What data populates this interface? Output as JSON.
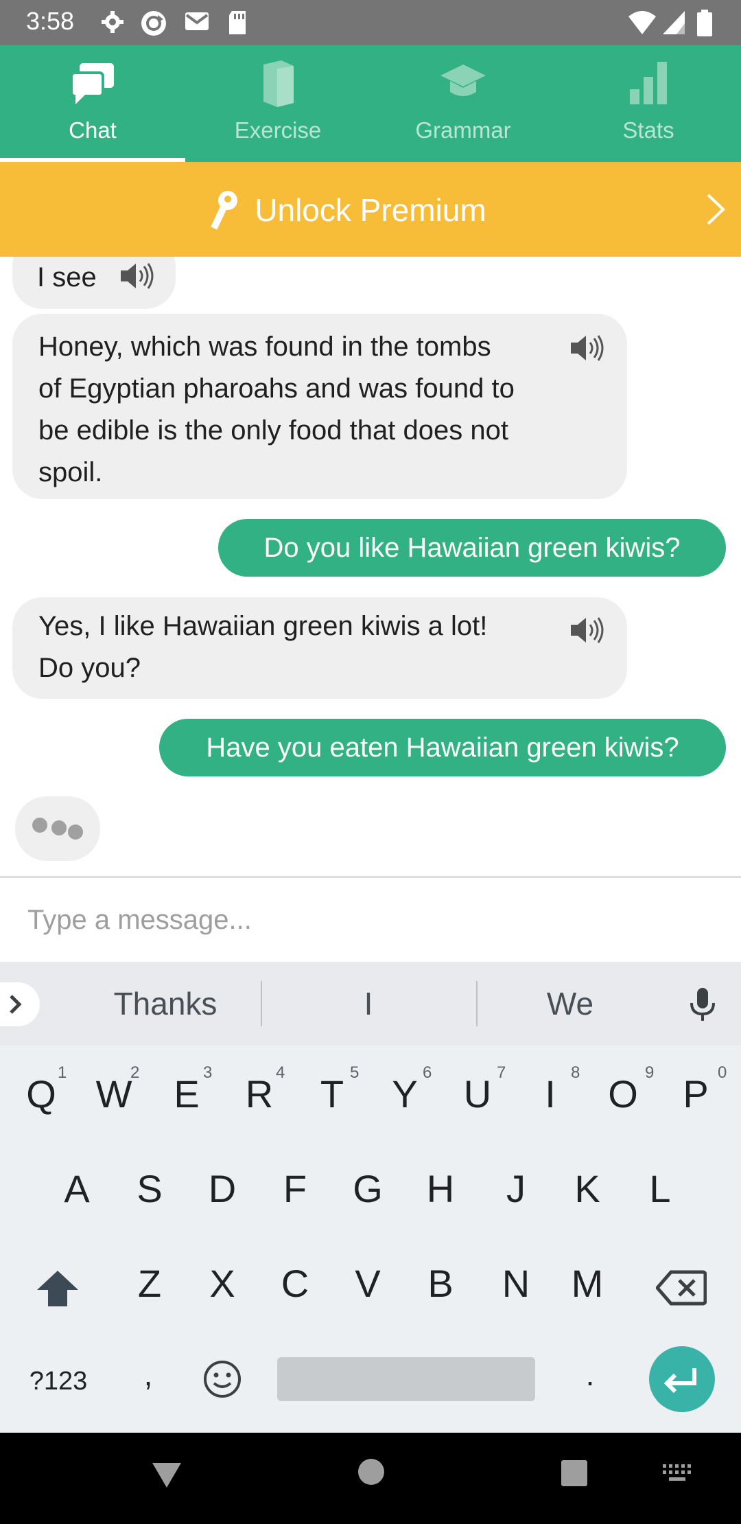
{
  "status_bar": {
    "time": "3:58"
  },
  "tabs": [
    {
      "label": "Chat",
      "active": true
    },
    {
      "label": "Exercise",
      "active": false
    },
    {
      "label": "Grammar",
      "active": false
    },
    {
      "label": "Stats",
      "active": false
    }
  ],
  "premium_banner": {
    "label": "Unlock Premium"
  },
  "messages": [
    {
      "from": "bot",
      "text": "I see"
    },
    {
      "from": "bot",
      "lines": [
        "Honey, which was found in the tombs",
        "of Egyptian pharoahs and was found to",
        "be edible is the only food that does not",
        "spoil."
      ]
    },
    {
      "from": "user",
      "text": "Do you like Hawaiian green kiwis?"
    },
    {
      "from": "bot",
      "lines": [
        "Yes, I like Hawaiian green kiwis a lot!",
        "Do you?"
      ]
    },
    {
      "from": "user",
      "text": "Have you eaten Hawaiian green kiwis?"
    }
  ],
  "composer": {
    "placeholder": "Type a message..."
  },
  "keyboard": {
    "suggestions": [
      "Thanks",
      "I",
      "We"
    ],
    "row1": [
      "Q",
      "W",
      "E",
      "R",
      "T",
      "Y",
      "U",
      "I",
      "O",
      "P"
    ],
    "row1_hints": [
      "1",
      "2",
      "3",
      "4",
      "5",
      "6",
      "7",
      "8",
      "9",
      "0"
    ],
    "row2": [
      "A",
      "S",
      "D",
      "F",
      "G",
      "H",
      "J",
      "K",
      "L"
    ],
    "row3": [
      "Z",
      "X",
      "C",
      "V",
      "B",
      "N",
      "M"
    ],
    "symbols_key": "?123",
    "comma_key": ",",
    "period_key": "."
  },
  "colors": {
    "brand_green": "#31b184",
    "premium_yellow": "#f8bd38"
  }
}
